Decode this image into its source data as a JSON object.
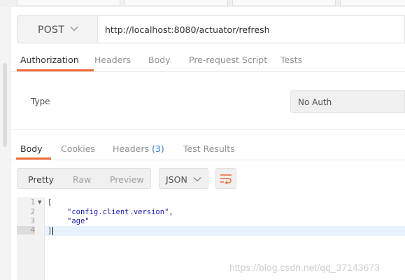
{
  "request": {
    "method": "POST",
    "url": "http://localhost:8080/actuator/refresh",
    "tabs": [
      "Authorization",
      "Headers",
      "Body",
      "Pre-request Script",
      "Tests"
    ],
    "active_tab": "Authorization"
  },
  "auth": {
    "type_label": "Type",
    "type_value": "No Auth"
  },
  "response": {
    "tabs": {
      "body": "Body",
      "cookies": "Cookies",
      "headers": "Headers",
      "headers_count": "(3)",
      "test_results": "Test Results"
    },
    "view_modes": [
      "Pretty",
      "Raw",
      "Preview"
    ],
    "active_view": "Pretty",
    "format": "JSON",
    "line_numbers": [
      "1",
      "2",
      "3",
      "4"
    ],
    "lines": [
      "[",
      "\"config.client.version\",",
      "\"age\"",
      "]"
    ]
  },
  "watermark": "https://blog.csdn.net/qq_37143673",
  "colors": {
    "accent": "#f26b3a",
    "count": "#2f7fd3",
    "string": "#1a1aa6"
  }
}
